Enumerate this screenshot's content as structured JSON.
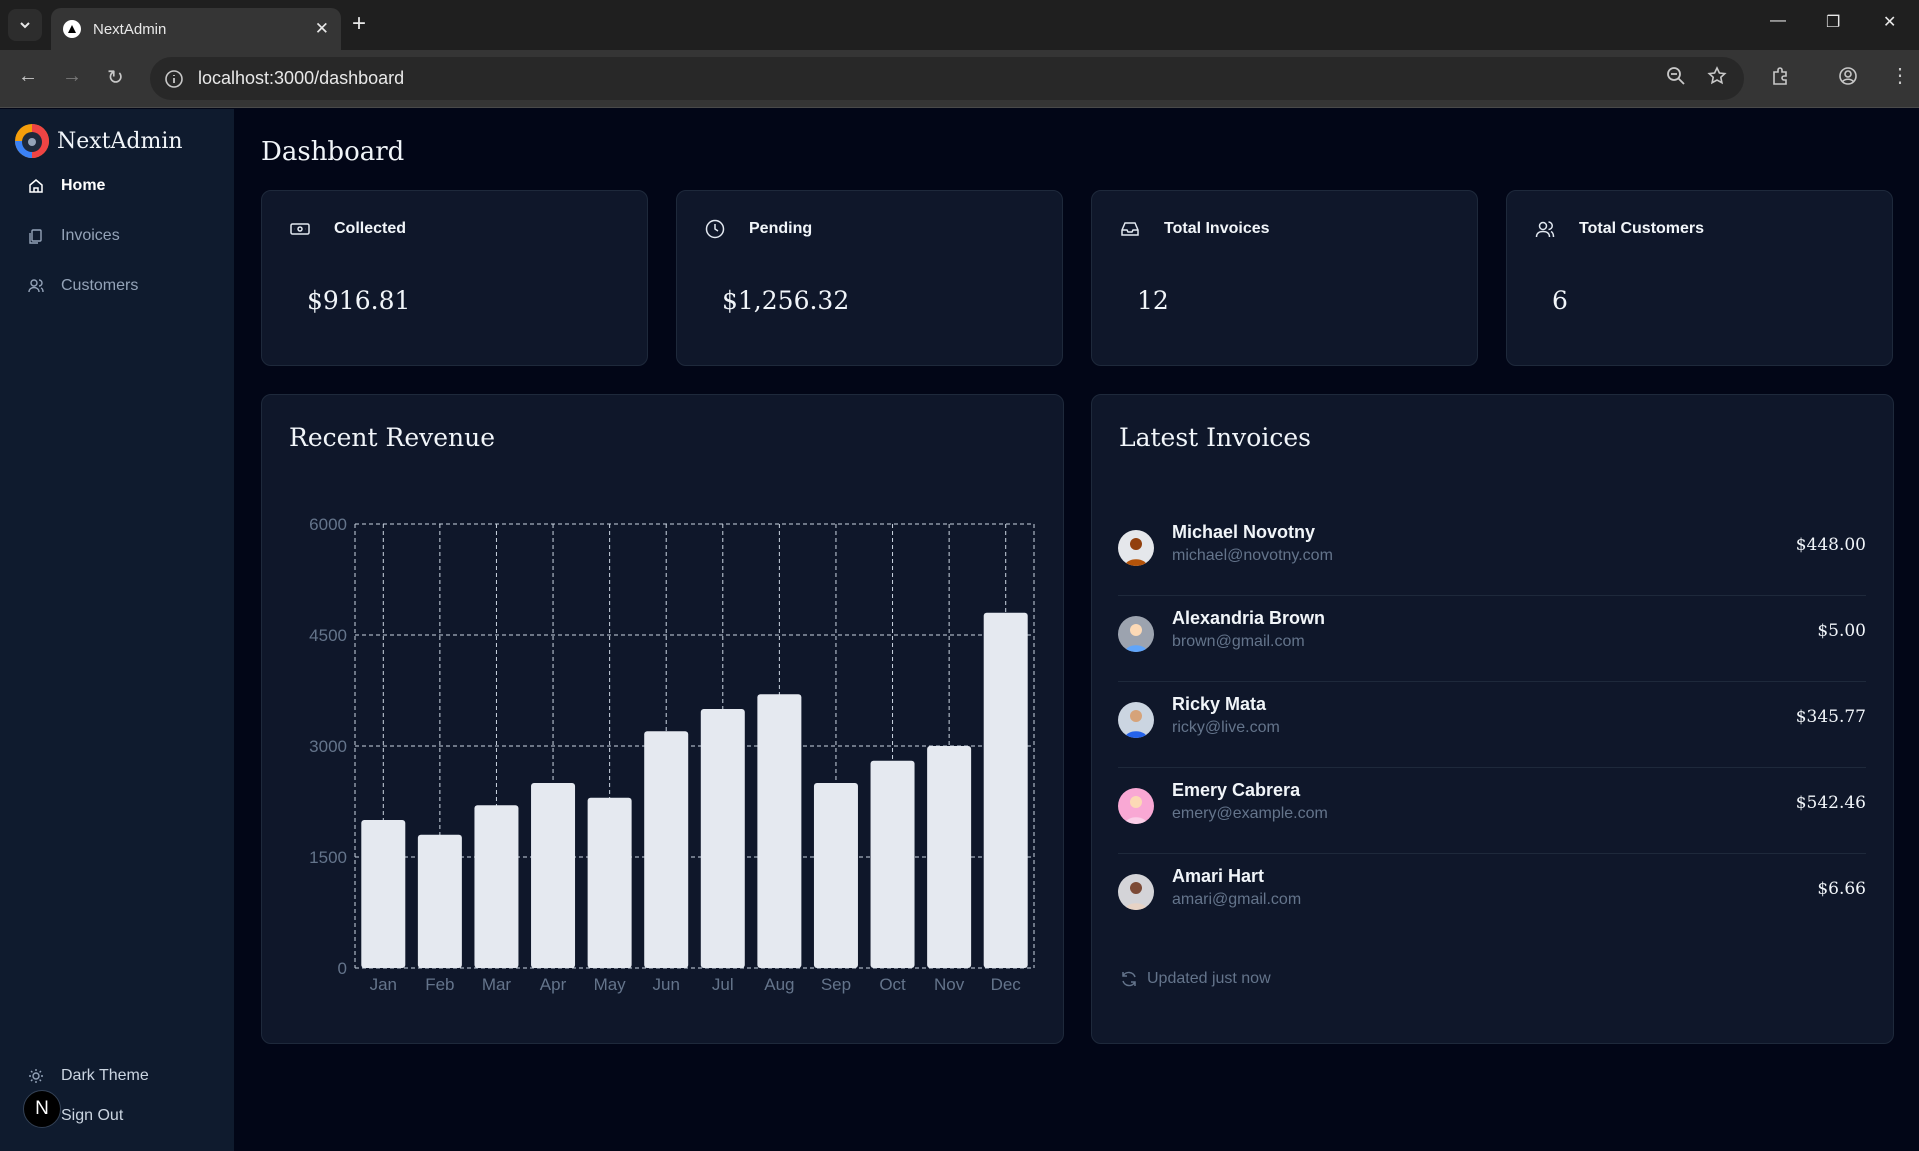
{
  "browser": {
    "tab_title": "NextAdmin",
    "url": "localhost:3000/dashboard"
  },
  "sidebar": {
    "brand": "NextAdmin",
    "items": [
      {
        "label": "Home",
        "icon": "home-icon",
        "active": true
      },
      {
        "label": "Invoices",
        "icon": "invoices-icon",
        "active": false
      },
      {
        "label": "Customers",
        "icon": "customers-icon",
        "active": false
      }
    ],
    "theme_label": "Dark Theme",
    "signout_label": "Sign Out",
    "avatar_letter": "N"
  },
  "page": {
    "title": "Dashboard"
  },
  "cards": [
    {
      "label": "Collected",
      "value": "$916.81",
      "icon": "banknote-icon"
    },
    {
      "label": "Pending",
      "value": "$1,256.32",
      "icon": "clock-icon"
    },
    {
      "label": "Total Invoices",
      "value": "12",
      "icon": "inbox-icon"
    },
    {
      "label": "Total Customers",
      "value": "6",
      "icon": "users-icon"
    }
  ],
  "revenue": {
    "title": "Recent Revenue"
  },
  "chart_data": {
    "type": "bar",
    "title": "Recent Revenue",
    "categories": [
      "Jan",
      "Feb",
      "Mar",
      "Apr",
      "May",
      "Jun",
      "Jul",
      "Aug",
      "Sep",
      "Oct",
      "Nov",
      "Dec"
    ],
    "values": [
      2000,
      1800,
      2200,
      2500,
      2300,
      3200,
      3500,
      3700,
      2500,
      2800,
      3000,
      4800
    ],
    "yticks": [
      "0",
      "1500",
      "3000",
      "4500",
      "6000"
    ],
    "ylim": [
      0,
      6000
    ],
    "grid": true
  },
  "invoices": {
    "title": "Latest Invoices",
    "rows": [
      {
        "name": "Michael Novotny",
        "email": "michael@novotny.com",
        "amount": "$448.00"
      },
      {
        "name": "Alexandria Brown",
        "email": "brown@gmail.com",
        "amount": "$5.00"
      },
      {
        "name": "Ricky Mata",
        "email": "ricky@live.com",
        "amount": "$345.77"
      },
      {
        "name": "Emery Cabrera",
        "email": "emery@example.com",
        "amount": "$542.46"
      },
      {
        "name": "Amari Hart",
        "email": "amari@gmail.com",
        "amount": "$6.66"
      }
    ],
    "updated": "Updated just now"
  }
}
